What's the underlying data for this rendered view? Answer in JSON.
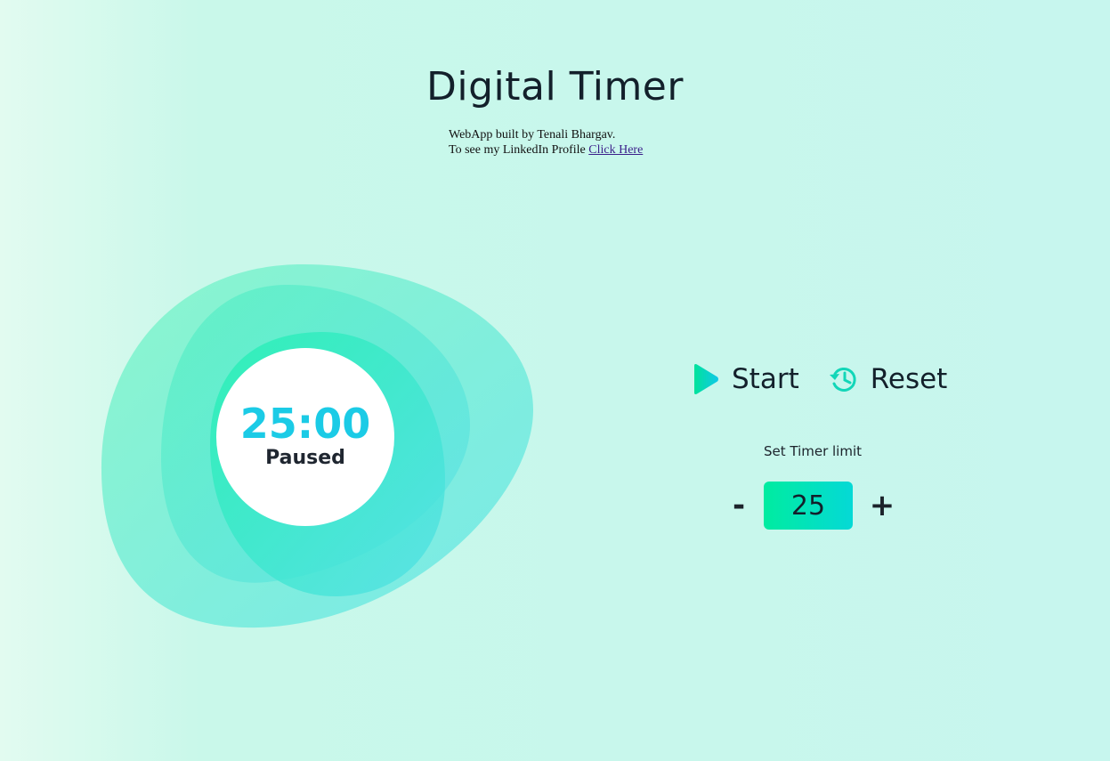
{
  "header": {
    "title": "Digital Timer",
    "credit_line": "WebApp built by Tenali Bhargav.",
    "profile_prefix": "To see my LinkedIn Profile",
    "profile_link": "Click Here"
  },
  "timer": {
    "time": "25:00",
    "status": "Paused"
  },
  "controls": {
    "start_label": "Start",
    "start_icon": "play-icon",
    "reset_label": "Reset",
    "reset_icon": "history-icon"
  },
  "limit": {
    "label": "Set Timer limit",
    "decrement_label": "-",
    "value": "25",
    "increment_label": "+"
  },
  "colors": {
    "accent_green": "#00eca0",
    "accent_cyan": "#1bcbe6",
    "text_dark": "#13202b"
  }
}
